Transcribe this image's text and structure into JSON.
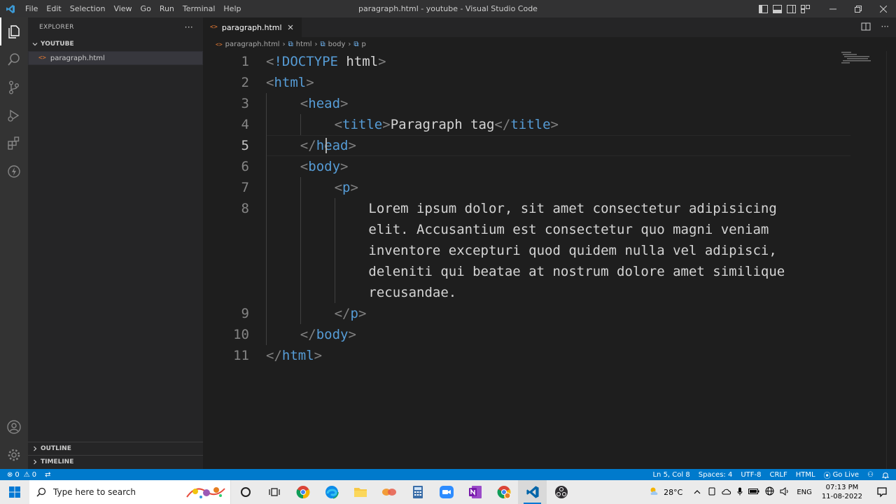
{
  "window": {
    "title": "paragraph.html - youtube - Visual Studio Code",
    "menu": [
      "File",
      "Edit",
      "Selection",
      "View",
      "Go",
      "Run",
      "Terminal",
      "Help"
    ]
  },
  "sidebar": {
    "header": "EXPLORER",
    "folder": "YOUTUBE",
    "files": [
      "paragraph.html"
    ],
    "panels": [
      "OUTLINE",
      "TIMELINE"
    ]
  },
  "editor": {
    "tab": "paragraph.html",
    "breadcrumbs": [
      "paragraph.html",
      "html",
      "body",
      "p"
    ],
    "current_line": 5,
    "lines": [
      {
        "n": "1",
        "indent": 0,
        "parts": [
          [
            "tg",
            "<"
          ],
          [
            "tn",
            "!DOCTYPE"
          ],
          [
            "tx",
            " html"
          ],
          [
            "tg",
            ">"
          ]
        ]
      },
      {
        "n": "2",
        "indent": 0,
        "parts": [
          [
            "tg",
            "<"
          ],
          [
            "tn",
            "html"
          ],
          [
            "tg",
            ">"
          ]
        ]
      },
      {
        "n": "3",
        "indent": 1,
        "parts": [
          [
            "tg",
            "<"
          ],
          [
            "tn",
            "head"
          ],
          [
            "tg",
            ">"
          ]
        ]
      },
      {
        "n": "4",
        "indent": 2,
        "parts": [
          [
            "tg",
            "<"
          ],
          [
            "tn",
            "title"
          ],
          [
            "tg",
            ">"
          ],
          [
            "tx",
            "Paragraph tag"
          ],
          [
            "tg",
            "</"
          ],
          [
            "tn",
            "title"
          ],
          [
            "tg",
            ">"
          ]
        ]
      },
      {
        "n": "5",
        "indent": 1,
        "parts": [
          [
            "tg",
            "</"
          ],
          [
            "tn",
            "head"
          ],
          [
            "tg",
            ">"
          ]
        ]
      },
      {
        "n": "6",
        "indent": 1,
        "parts": [
          [
            "tg",
            "<"
          ],
          [
            "tn",
            "body"
          ],
          [
            "tg",
            ">"
          ]
        ]
      },
      {
        "n": "7",
        "indent": 2,
        "parts": [
          [
            "tg",
            "<"
          ],
          [
            "tn",
            "p"
          ],
          [
            "tg",
            ">"
          ]
        ]
      },
      {
        "n": "8",
        "indent": 3,
        "parts": [
          [
            "tx",
            "Lorem ipsum dolor, sit amet consectetur adipisicing"
          ]
        ]
      },
      {
        "n": "",
        "indent": 3,
        "parts": [
          [
            "tx",
            "elit. Accusantium est consectetur quo magni veniam"
          ]
        ]
      },
      {
        "n": "",
        "indent": 3,
        "parts": [
          [
            "tx",
            "inventore excepturi quod quidem nulla vel adipisci,"
          ]
        ]
      },
      {
        "n": "",
        "indent": 3,
        "parts": [
          [
            "tx",
            "deleniti qui beatae at nostrum dolore amet similique"
          ]
        ]
      },
      {
        "n": "",
        "indent": 3,
        "parts": [
          [
            "tx",
            "recusandae."
          ]
        ]
      },
      {
        "n": "9",
        "indent": 2,
        "parts": [
          [
            "tg",
            "</"
          ],
          [
            "tn",
            "p"
          ],
          [
            "tg",
            ">"
          ]
        ]
      },
      {
        "n": "10",
        "indent": 1,
        "parts": [
          [
            "tg",
            "</"
          ],
          [
            "tn",
            "body"
          ],
          [
            "tg",
            ">"
          ]
        ]
      },
      {
        "n": "11",
        "indent": 0,
        "parts": [
          [
            "tg",
            "</"
          ],
          [
            "tn",
            "html"
          ],
          [
            "tg",
            ">"
          ]
        ]
      }
    ]
  },
  "statusbar": {
    "errors": "0",
    "warnings": "0",
    "position": "Ln 5, Col 8",
    "spaces": "Spaces: 4",
    "encoding": "UTF-8",
    "eol": "CRLF",
    "language": "HTML",
    "golive": "Go Live"
  },
  "taskbar": {
    "search_placeholder": "Type here to search",
    "weather": "28°C",
    "language": "ENG",
    "time": "07:13 PM",
    "date": "11-08-2022"
  },
  "colors": {
    "accent": "#007acc",
    "tag_name": "#569cd6",
    "bracket": "#808080",
    "text": "#d4d4d4"
  }
}
